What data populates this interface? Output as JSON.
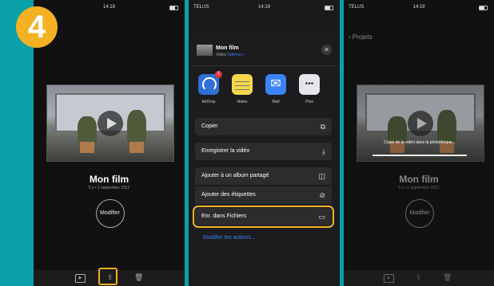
{
  "step_badge": "4",
  "screen1": {
    "time": "14:19",
    "movie_title": "Mon film",
    "movie_sub": "5 s • 1 septembre 2021",
    "modify_button": "Modifier",
    "toolbar_icons": [
      "play-icon",
      "share-icon",
      "trash-icon"
    ]
  },
  "screen2": {
    "carrier": "TELUS",
    "time": "14:19",
    "sheet_title": "Mon film",
    "sheet_sub_prefix": "Vidéo",
    "sheet_options": "Options >",
    "apps": [
      {
        "label": "AirDrop",
        "badge": "1",
        "color": "#2f6fd6"
      },
      {
        "label": "Notes",
        "color": "#f5d84a"
      },
      {
        "label": "Mail",
        "color": "#3b82f6"
      },
      {
        "label": "Plus",
        "color": "#e5e5ea"
      }
    ],
    "actions": [
      {
        "label": "Copier",
        "icon": "copy-icon"
      },
      {
        "label": "Enregistrer la vidéo",
        "icon": "download-icon"
      },
      {
        "label": "Ajouter à un album partagé",
        "icon": "shared-album-icon"
      },
      {
        "label": "Ajouter des étiquettes",
        "icon": "tag-icon"
      },
      {
        "label": "Enr. dans Fichiers",
        "icon": "folder-icon"
      }
    ],
    "edit_actions_link": "Modifier les actions..."
  },
  "screen3": {
    "carrier": "TELUS",
    "time": "14:19",
    "back_label": "Projets",
    "toast": "Copie de la vidéo dans la photothèque...",
    "movie_title": "Mon film",
    "movie_sub": "5 s • 1 septembre 2021",
    "modify_button": "Modifier"
  },
  "colors": {
    "background": "#0aa0a8",
    "highlight": "#f4b223",
    "link": "#3b82f6"
  }
}
